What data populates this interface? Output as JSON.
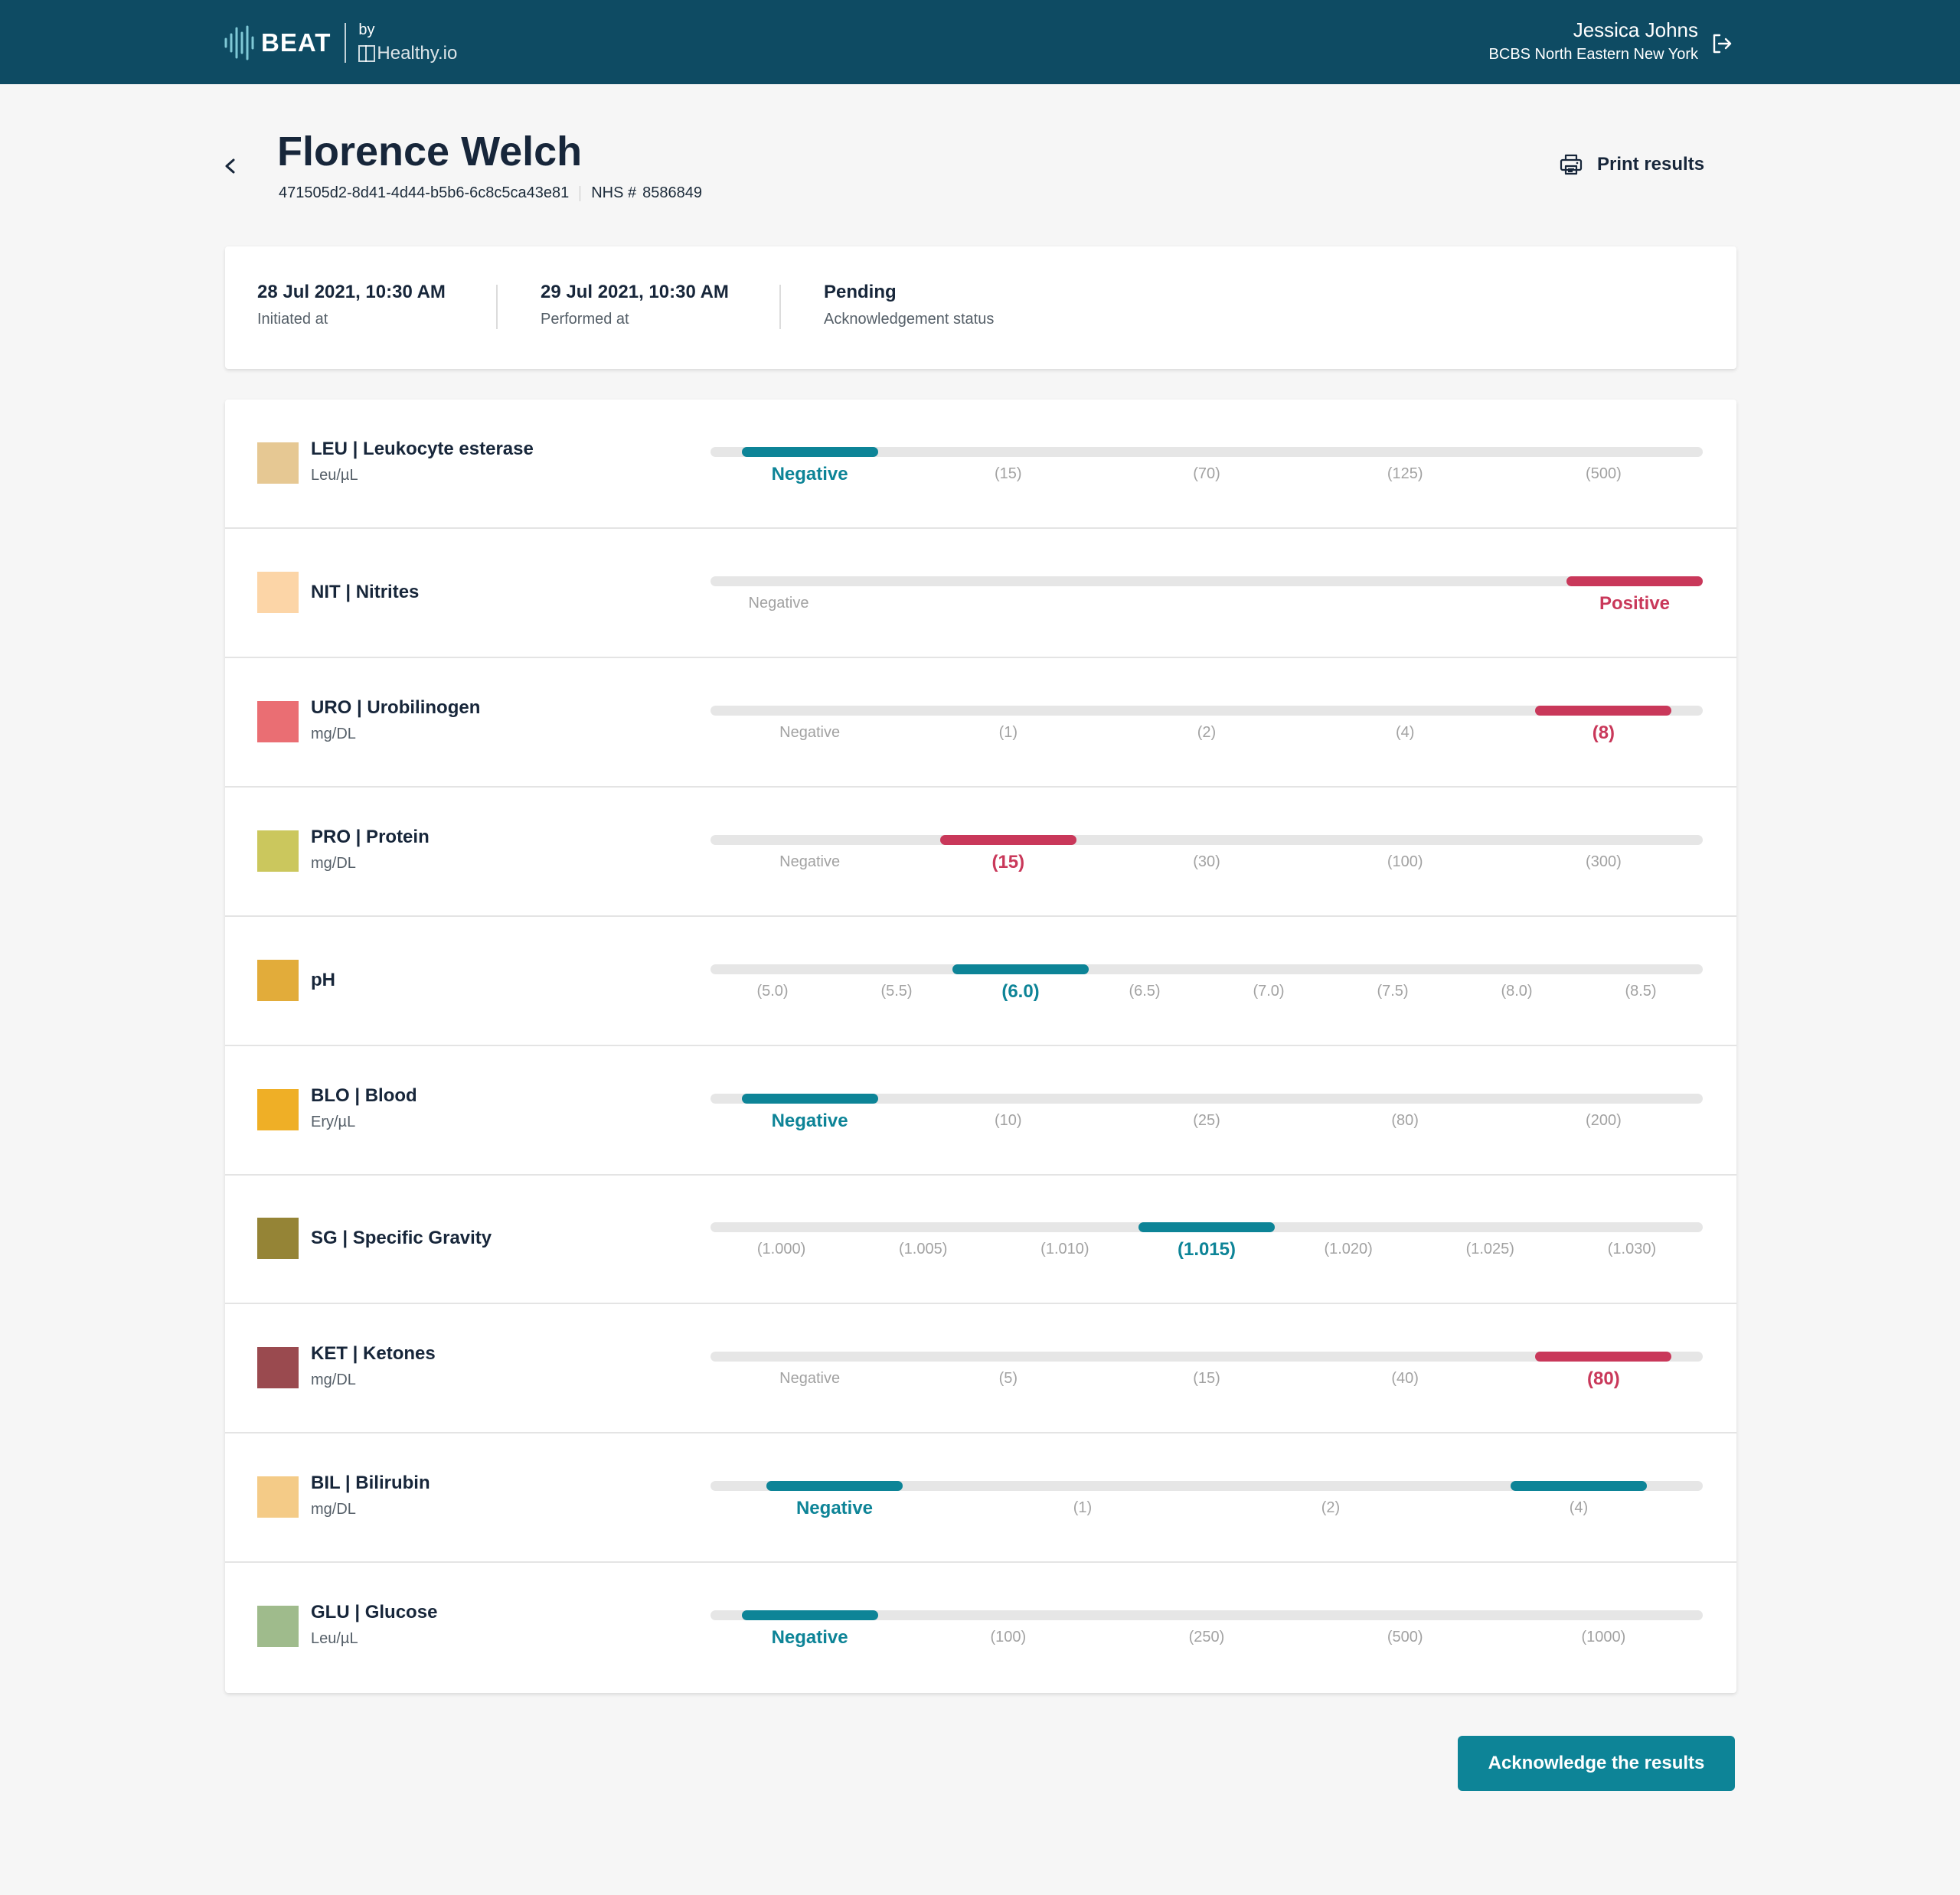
{
  "header": {
    "brand": "BEAT",
    "by": "by",
    "partner": "Healthy.io",
    "user_name": "Jessica Johns",
    "user_org": "BCBS North Eastern New York",
    "logout_icon": "logout-icon"
  },
  "patient": {
    "name": "Florence Welch",
    "id": "471505d2-8d41-4d44-b5b6-6c8c5ca43e81",
    "nhs_label": "NHS #",
    "nhs_number": "8586849",
    "print_label": "Print results"
  },
  "info": {
    "initiated_value": "28 Jul 2021, 10:30 AM",
    "initiated_label": "Initiated at",
    "performed_value": "29 Jul 2021, 10:30 AM",
    "performed_label": "Performed at",
    "status_value": "Pending",
    "status_label": "Acknowledgement status"
  },
  "colors": {
    "header_bg": "#0e4b63",
    "accent_teal": "#0d8497",
    "alert_red": "#c9385a",
    "track_gray": "#e6e6e6"
  },
  "tests": [
    {
      "name": "LEU | Leukocyte esterase",
      "unit": "Leu/µL",
      "color": "#e6c893",
      "scale": [
        "Negative",
        "(15)",
        "(70)",
        "(125)",
        "(500)"
      ],
      "highlighted": [
        0
      ],
      "status": "normal"
    },
    {
      "name": "NIT | Nitrites",
      "unit": "",
      "color": "#fcd5a7",
      "scale": [
        "Negative",
        "Positive"
      ],
      "highlighted": [
        1
      ],
      "status": "abnormal"
    },
    {
      "name": "URO | Urobilinogen",
      "unit": "mg/DL",
      "color": "#ea6e73",
      "scale": [
        "Negative",
        "(1)",
        "(2)",
        "(4)",
        "(8)"
      ],
      "highlighted": [
        4
      ],
      "status": "abnormal"
    },
    {
      "name": "PRO | Protein",
      "unit": "mg/DL",
      "color": "#cbc75d",
      "scale": [
        "Negative",
        "(15)",
        "(30)",
        "(100)",
        "(300)"
      ],
      "highlighted": [
        1
      ],
      "status": "abnormal"
    },
    {
      "name": "pH",
      "unit": "",
      "color": "#e2ac3a",
      "scale": [
        "(5.0)",
        "(5.5)",
        "(6.0)",
        "(6.5)",
        "(7.0)",
        "(7.5)",
        "(8.0)",
        "(8.5)"
      ],
      "highlighted": [
        2
      ],
      "status": "normal"
    },
    {
      "name": "BLO | Blood",
      "unit": "Ery/µL",
      "color": "#efaf26",
      "scale": [
        "Negative",
        "(10)",
        "(25)",
        "(80)",
        "(200)"
      ],
      "highlighted": [
        0
      ],
      "status": "normal"
    },
    {
      "name": "SG | Specific Gravity",
      "unit": "",
      "color": "#958436",
      "scale": [
        "(1.000)",
        "(1.005)",
        "(1.010)",
        "(1.015)",
        "(1.020)",
        "(1.025)",
        "(1.030)"
      ],
      "highlighted": [
        3
      ],
      "status": "normal"
    },
    {
      "name": "KET | Ketones",
      "unit": "mg/DL",
      "color": "#9a4a4f",
      "scale": [
        "Negative",
        "(5)",
        "(15)",
        "(40)",
        "(80)"
      ],
      "highlighted": [
        4
      ],
      "status": "abnormal"
    },
    {
      "name": "BIL | Bilirubin",
      "unit": "mg/DL",
      "color": "#f4cb87",
      "scale": [
        "Negative",
        "(1)",
        "(2)",
        "(4)"
      ],
      "highlighted": [
        0,
        3
      ],
      "status": "normal"
    },
    {
      "name": "GLU | Glucose",
      "unit": "Leu/µL",
      "color": "#9fbb8c",
      "scale": [
        "Negative",
        "(100)",
        "(250)",
        "(500)",
        "(1000)"
      ],
      "highlighted": [
        0
      ],
      "status": "normal"
    }
  ],
  "actions": {
    "acknowledge_label": "Acknowledge the results"
  }
}
